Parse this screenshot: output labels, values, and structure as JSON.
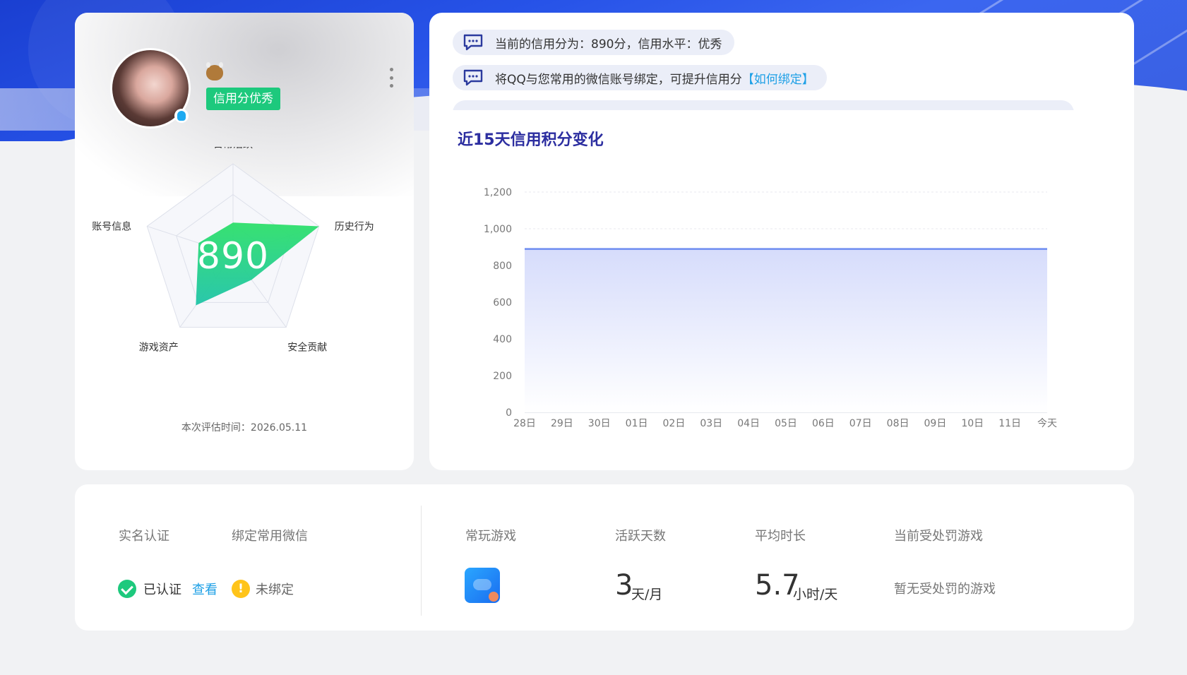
{
  "profile": {
    "credit_badge": "信用分优秀",
    "score": "890",
    "eval_time": "本次评估时间：2026.05.11",
    "radar": {
      "axes": [
        "日常活跃",
        "历史行为",
        "安全贡献",
        "游戏资产",
        "账号信息"
      ],
      "values": [
        0.35,
        1.0,
        0.35,
        0.7,
        0.4
      ]
    }
  },
  "notices": [
    {
      "text": "当前的信用分为：890分，信用水平：优秀",
      "link": ""
    },
    {
      "text": "将QQ与您常用的微信账号绑定，可提升信用分",
      "link": "【如何绑定】"
    }
  ],
  "chart_title": "近15天信用积分变化",
  "chart_data": {
    "type": "area",
    "categories": [
      "28日",
      "29日",
      "30日",
      "01日",
      "02日",
      "03日",
      "04日",
      "05日",
      "06日",
      "07日",
      "08日",
      "09日",
      "10日",
      "11日",
      "今天"
    ],
    "values": [
      890,
      890,
      890,
      890,
      890,
      890,
      890,
      890,
      890,
      890,
      890,
      890,
      890,
      890,
      890
    ],
    "ylim": [
      0,
      1200
    ],
    "yticks": [
      "0",
      "200",
      "400",
      "600",
      "800",
      "1,000",
      "1,200"
    ],
    "grid": true,
    "line_color": "#6d8cf0"
  },
  "stats": {
    "realname_label": "实名认证",
    "wechat_label": "绑定常用微信",
    "verified_text": "已认证",
    "view_link": "查看",
    "warn_glyph": "!",
    "unbound_text": "未绑定",
    "game_label": "常玩游戏",
    "active_days_label": "活跃天数",
    "active_days_value": "3",
    "active_days_unit": "天/月",
    "avg_time_label": "平均时长",
    "avg_time_value": "5.7",
    "avg_time_unit": "小时/天",
    "punish_label": "当前受处罚游戏",
    "punish_value": "暂无受处罚的游戏"
  },
  "colors": {
    "accent_green": "#1dc97d",
    "link_blue": "#1ea0e6",
    "title_navy": "#2c2ea0",
    "warn_yellow": "#ffc41a"
  }
}
